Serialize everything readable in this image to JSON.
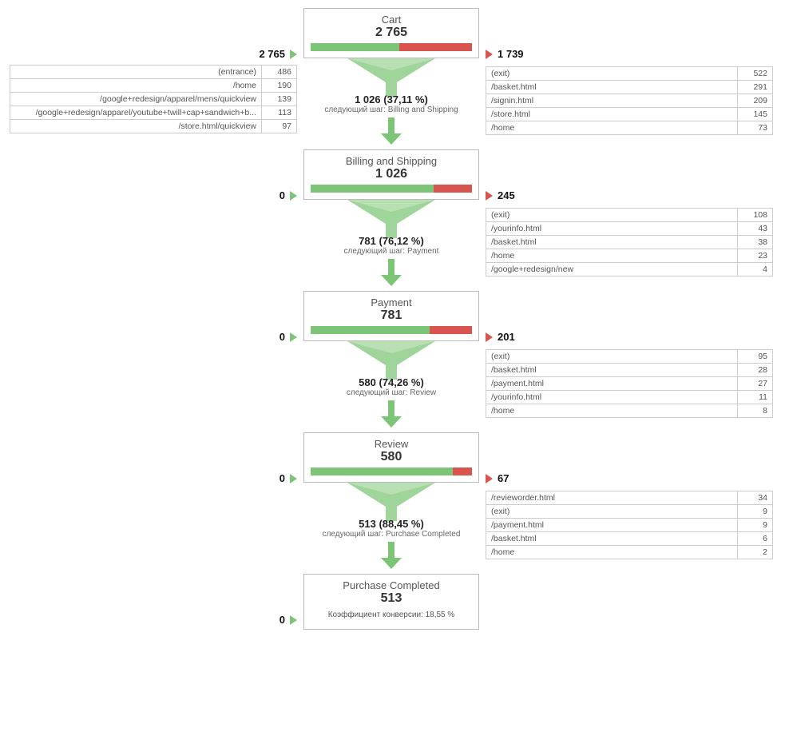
{
  "steps": [
    {
      "title": "Cart",
      "count": "2 765",
      "inflow": "2 765",
      "outflow": "1 739",
      "green_pct": 55,
      "proceed_main": "1 026 (37,11 %)",
      "proceed_sub": "следующий шаг: Billing and Shipping",
      "left_rows": [
        {
          "label": "(entrance)",
          "val": "486"
        },
        {
          "label": "/home",
          "val": "190"
        },
        {
          "label": "/google+redesign/apparel/mens/quickview",
          "val": "139"
        },
        {
          "label": "/google+redesign/apparel/youtube+twill+cap+sandwich+b...",
          "val": "113"
        },
        {
          "label": "/store.html/quickview",
          "val": "97"
        }
      ],
      "right_rows": [
        {
          "label": "(exit)",
          "val": "522"
        },
        {
          "label": "/basket.html",
          "val": "291"
        },
        {
          "label": "/signin.html",
          "val": "209"
        },
        {
          "label": "/store.html",
          "val": "145"
        },
        {
          "label": "/home",
          "val": "73"
        }
      ]
    },
    {
      "title": "Billing and Shipping",
      "count": "1 026",
      "inflow": "0",
      "outflow": "245",
      "green_pct": 76,
      "proceed_main": "781 (76,12 %)",
      "proceed_sub": "следующий шаг: Payment",
      "left_rows": [],
      "right_rows": [
        {
          "label": "(exit)",
          "val": "108"
        },
        {
          "label": "/yourinfo.html",
          "val": "43"
        },
        {
          "label": "/basket.html",
          "val": "38"
        },
        {
          "label": "/home",
          "val": "23"
        },
        {
          "label": "/google+redesign/new",
          "val": "4"
        }
      ]
    },
    {
      "title": "Payment",
      "count": "781",
      "inflow": "0",
      "outflow": "201",
      "green_pct": 74,
      "proceed_main": "580 (74,26 %)",
      "proceed_sub": "следующий шаг: Review",
      "left_rows": [],
      "right_rows": [
        {
          "label": "(exit)",
          "val": "95"
        },
        {
          "label": "/basket.html",
          "val": "28"
        },
        {
          "label": "/payment.html",
          "val": "27"
        },
        {
          "label": "/yourinfo.html",
          "val": "11"
        },
        {
          "label": "/home",
          "val": "8"
        }
      ]
    },
    {
      "title": "Review",
      "count": "580",
      "inflow": "0",
      "outflow": "67",
      "green_pct": 88,
      "proceed_main": "513 (88,45 %)",
      "proceed_sub": "следующий шаг: Purchase Completed",
      "left_rows": [],
      "right_rows": [
        {
          "label": "/revieworder.html",
          "val": "34"
        },
        {
          "label": "(exit)",
          "val": "9"
        },
        {
          "label": "/payment.html",
          "val": "9"
        },
        {
          "label": "/basket.html",
          "val": "6"
        },
        {
          "label": "/home",
          "val": "2"
        }
      ]
    },
    {
      "title": "Purchase Completed",
      "count": "513",
      "inflow": "0",
      "outflow": "",
      "green_pct": 100,
      "final_rate": "Коэффициент конверсии: 18,55 %",
      "left_rows": [],
      "right_rows": []
    }
  ]
}
